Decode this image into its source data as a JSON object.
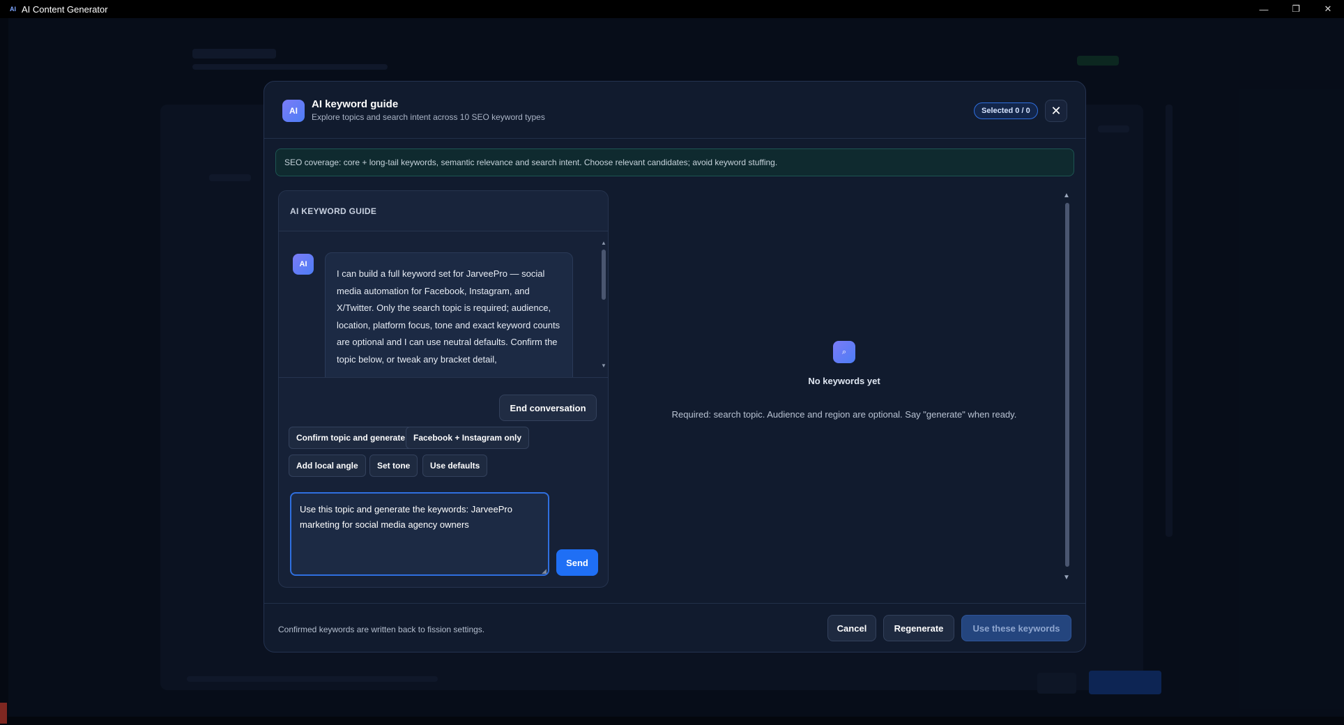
{
  "window": {
    "title": "AI Content Generator",
    "app_icon": "AI",
    "minimize": "—",
    "restore": "❐",
    "close": "✕"
  },
  "modal": {
    "badge": "AI",
    "title": "AI keyword guide",
    "subtitle": "Explore topics and search intent across 10 SEO keyword types",
    "selected_label": "Selected 0 / 0",
    "close_icon": "✕"
  },
  "notice": "SEO coverage: core + long-tail keywords, semantic relevance and search intent. Choose relevant candidates; avoid keyword stuffing.",
  "chat": {
    "header": "AI KEYWORD GUIDE",
    "message_badge": "AI",
    "message": "I can build a full keyword set for JarveePro — social media automation for Facebook, Instagram, and X/Twitter. Only the search topic is required; audience, location, platform focus, tone and exact keyword counts are optional and I can use neutral defaults. Confirm the topic below, or tweak any bracket detail,",
    "end_button": "End conversation",
    "chips": [
      "Confirm topic and generate",
      "Facebook + Instagram only",
      "Add local angle",
      "Set tone",
      "Use defaults"
    ],
    "input_value": "Use this topic and generate the keywords: JarveePro marketing for social media agency owners",
    "send_button": "Send"
  },
  "results": {
    "empty_icon": "⌕",
    "empty_title": "No keywords yet",
    "empty_hint": "Required: search topic. Audience and region are optional. Say \"generate\" when ready."
  },
  "footer": {
    "note": "Confirmed keywords are written back to fission settings.",
    "cancel": "Cancel",
    "regenerate": "Regenerate",
    "use": "Use these keywords"
  },
  "colors": {
    "accent": "#1f6ff5",
    "modal_bg": "#111b2e",
    "notice_bg": "#0f2a2f"
  }
}
